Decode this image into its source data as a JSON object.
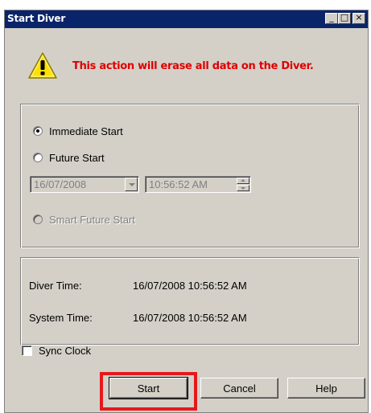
{
  "window": {
    "title": "Start Diver",
    "controls": {
      "minimize": "_",
      "maximize": "□",
      "close": "×"
    }
  },
  "warning": {
    "icon": "warning-icon",
    "message": "This action will erase all data on the Diver."
  },
  "start_options": {
    "immediate_label": "Immediate Start",
    "immediate_selected": true,
    "future_label": "Future Start",
    "future_selected": false,
    "date_value": "16/07/2008",
    "time_value": "10:56:52 AM",
    "smart_future_label": "Smart Future Start",
    "smart_future_enabled": false
  },
  "times": {
    "diver_label": "Diver Time:",
    "diver_value": "16/07/2008 10:56:52 AM",
    "system_label": "System Time:",
    "system_value": "16/07/2008 10:56:52 AM"
  },
  "sync_clock": {
    "label": "Sync Clock",
    "checked": false
  },
  "buttons": {
    "start": "Start",
    "cancel": "Cancel",
    "help": "Help"
  },
  "colors": {
    "title_bar": "#0a246a",
    "warning_text": "#e00000",
    "highlight_box": "#e5191b",
    "dialog_face": "#d4d0c8"
  }
}
